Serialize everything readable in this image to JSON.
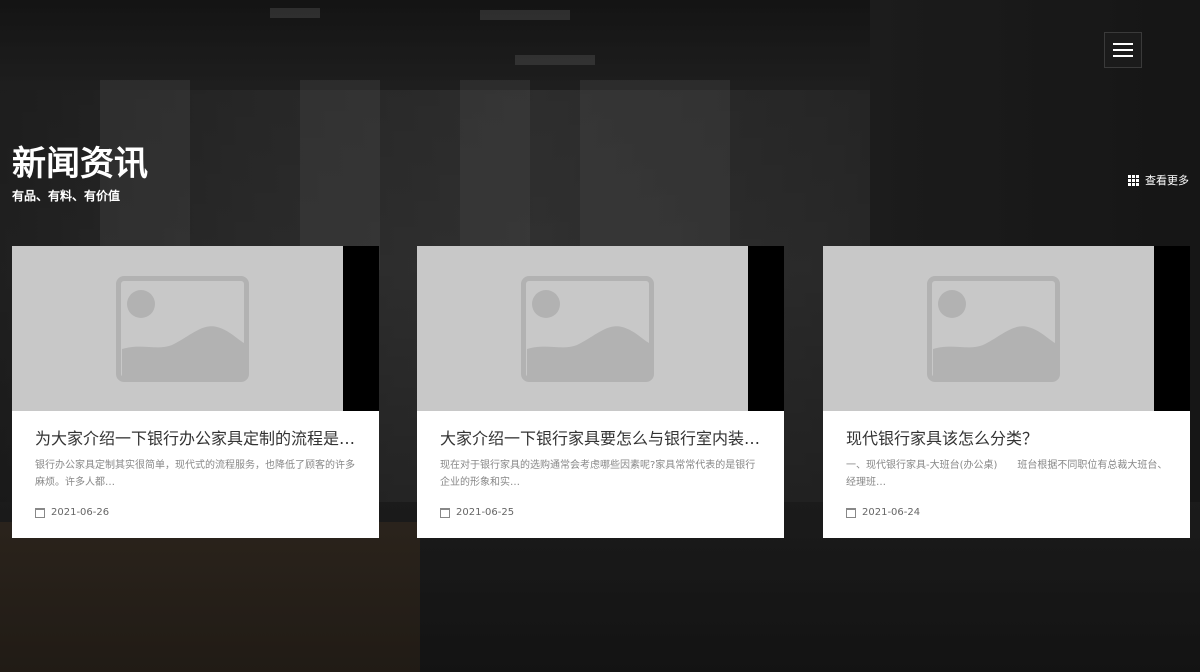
{
  "header": {
    "menu_icon": "hamburger-menu-icon"
  },
  "section": {
    "title": "新闻资讯",
    "subtitle": "有品、有料、有价值",
    "view_more": "查看更多",
    "view_more_icon": "grid-icon"
  },
  "news": [
    {
      "title": "为大家介绍一下银行办公家具定制的流程是…",
      "excerpt": "银行办公家具定制其实很简单，现代式的流程服务，也降低了顾客的许多麻烦。许多人都…",
      "date": "2021-06-26",
      "image_icon": "image-placeholder-icon"
    },
    {
      "title": "大家介绍一下银行家具要怎么与银行室内装…",
      "excerpt": "现在对于银行家具的选购通常会考虑哪些因素呢?家具常常代表的是银行企业的形象和实…",
      "date": "2021-06-25",
      "image_icon": "image-placeholder-icon"
    },
    {
      "title": "现代银行家具该怎么分类？",
      "excerpt": "一、现代银行家具-大班台(办公桌)　　班台根据不同职位有总裁大班台、经理班…",
      "date": "2021-06-24",
      "image_icon": "image-placeholder-icon"
    }
  ],
  "colors": {
    "overlay": "#000000",
    "card_bg": "#ffffff",
    "placeholder_bg": "#c8c8c8",
    "placeholder_fg": "#b2b2b2",
    "title_text": "#333333",
    "muted_text": "#888888"
  }
}
